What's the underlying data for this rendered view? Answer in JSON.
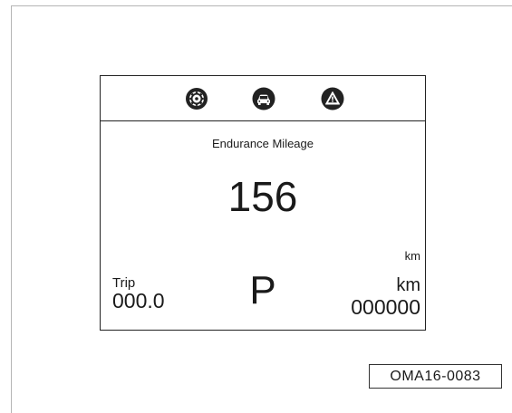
{
  "display": {
    "icons": [
      "settings-icon",
      "car-icon",
      "warning-icon"
    ],
    "title": "Endurance Mileage",
    "value": "156",
    "unit": "km",
    "trip_label": "Trip",
    "trip_value": "000.0",
    "gear": "P",
    "odo_unit": "km",
    "odo_value": "000000"
  },
  "figure_code": "OMA16-0083"
}
